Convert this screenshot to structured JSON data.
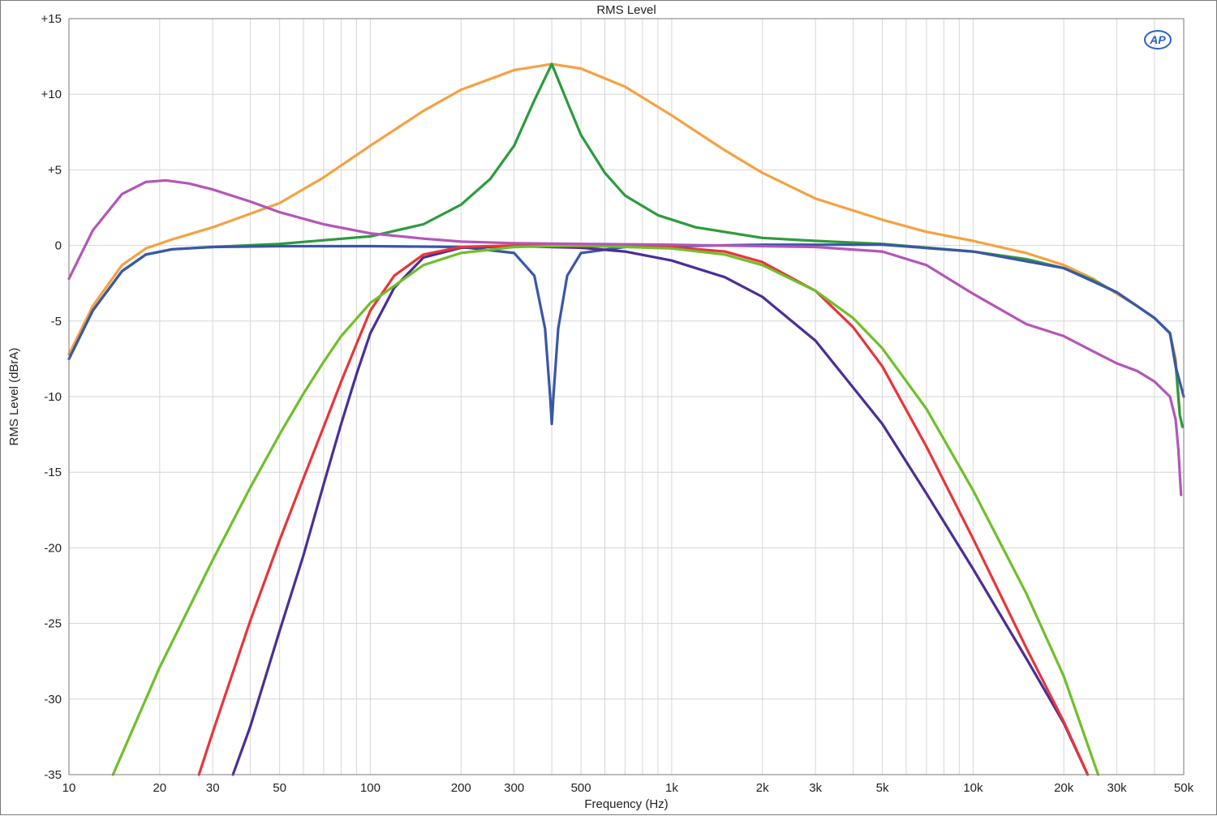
{
  "chart_data": {
    "type": "line",
    "title": "RMS Level",
    "xlabel": "Frequency (Hz)",
    "ylabel": "RMS Level (dBrA)",
    "xscale": "log",
    "xlim": [
      10,
      50000
    ],
    "ylim": [
      -35,
      15
    ],
    "grid": true,
    "x_tick_labels": [
      {
        "v": 10,
        "label": "10"
      },
      {
        "v": 20,
        "label": "20"
      },
      {
        "v": 30,
        "label": "30"
      },
      {
        "v": 50,
        "label": "50"
      },
      {
        "v": 100,
        "label": "100"
      },
      {
        "v": 200,
        "label": "200"
      },
      {
        "v": 300,
        "label": "300"
      },
      {
        "v": 500,
        "label": "500"
      },
      {
        "v": 1000,
        "label": "1k"
      },
      {
        "v": 2000,
        "label": "2k"
      },
      {
        "v": 3000,
        "label": "3k"
      },
      {
        "v": 5000,
        "label": "5k"
      },
      {
        "v": 10000,
        "label": "10k"
      },
      {
        "v": 20000,
        "label": "20k"
      },
      {
        "v": 30000,
        "label": "30k"
      },
      {
        "v": 50000,
        "label": "50k"
      }
    ],
    "y_tick_labels": [
      {
        "v": 15,
        "label": "+15"
      },
      {
        "v": 10,
        "label": "+10"
      },
      {
        "v": 5,
        "label": "+5"
      },
      {
        "v": 0,
        "label": "0"
      },
      {
        "v": -5,
        "label": "-5"
      },
      {
        "v": -10,
        "label": "-10"
      },
      {
        "v": -15,
        "label": "-15"
      },
      {
        "v": -20,
        "label": "-20"
      },
      {
        "v": -25,
        "label": "-25"
      },
      {
        "v": -30,
        "label": "-30"
      },
      {
        "v": -35,
        "label": "-35"
      }
    ],
    "series": [
      {
        "color": "#f5a142",
        "points": [
          [
            10,
            -7.2
          ],
          [
            12,
            -4.0
          ],
          [
            15,
            -1.3
          ],
          [
            18,
            -0.2
          ],
          [
            22,
            0.4
          ],
          [
            30,
            1.2
          ],
          [
            50,
            2.8
          ],
          [
            70,
            4.5
          ],
          [
            100,
            6.6
          ],
          [
            150,
            8.9
          ],
          [
            200,
            10.3
          ],
          [
            300,
            11.6
          ],
          [
            400,
            12.0
          ],
          [
            500,
            11.7
          ],
          [
            700,
            10.5
          ],
          [
            1000,
            8.6
          ],
          [
            1500,
            6.3
          ],
          [
            2000,
            4.8
          ],
          [
            3000,
            3.1
          ],
          [
            5000,
            1.7
          ],
          [
            7000,
            0.9
          ],
          [
            10000,
            0.3
          ],
          [
            15000,
            -0.5
          ],
          [
            20000,
            -1.3
          ],
          [
            25000,
            -2.2
          ],
          [
            30000,
            -3.2
          ],
          [
            35000,
            -4.0
          ],
          [
            40000,
            -4.8
          ],
          [
            45000,
            -5.8
          ],
          [
            47000,
            -7.5
          ],
          [
            48500,
            -11.0
          ]
        ]
      },
      {
        "color": "#2e9a3e",
        "points": [
          [
            10,
            -7.5
          ],
          [
            12,
            -4.3
          ],
          [
            15,
            -1.7
          ],
          [
            18,
            -0.6
          ],
          [
            22,
            -0.25
          ],
          [
            30,
            -0.1
          ],
          [
            50,
            0.1
          ],
          [
            100,
            0.6
          ],
          [
            150,
            1.4
          ],
          [
            200,
            2.7
          ],
          [
            250,
            4.4
          ],
          [
            300,
            6.6
          ],
          [
            350,
            9.6
          ],
          [
            400,
            12.0
          ],
          [
            450,
            9.5
          ],
          [
            500,
            7.3
          ],
          [
            600,
            4.8
          ],
          [
            700,
            3.3
          ],
          [
            900,
            2.0
          ],
          [
            1200,
            1.2
          ],
          [
            2000,
            0.5
          ],
          [
            3000,
            0.3
          ],
          [
            5000,
            0.1
          ],
          [
            10000,
            -0.4
          ],
          [
            15000,
            -0.9
          ],
          [
            20000,
            -1.5
          ],
          [
            25000,
            -2.3
          ],
          [
            30000,
            -3.1
          ],
          [
            35000,
            -4.0
          ],
          [
            40000,
            -4.8
          ],
          [
            45000,
            -5.8
          ],
          [
            47000,
            -7.8
          ],
          [
            48500,
            -11.2
          ],
          [
            49500,
            -12.0
          ]
        ]
      },
      {
        "color": "#3a56a8",
        "points": [
          [
            10,
            -7.5
          ],
          [
            12,
            -4.3
          ],
          [
            15,
            -1.7
          ],
          [
            18,
            -0.6
          ],
          [
            22,
            -0.25
          ],
          [
            30,
            -0.1
          ],
          [
            50,
            -0.05
          ],
          [
            100,
            -0.05
          ],
          [
            200,
            -0.1
          ],
          [
            300,
            -0.5
          ],
          [
            350,
            -2.0
          ],
          [
            380,
            -5.5
          ],
          [
            395,
            -10.0
          ],
          [
            400,
            -11.8
          ],
          [
            405,
            -10.0
          ],
          [
            420,
            -5.5
          ],
          [
            450,
            -2.0
          ],
          [
            500,
            -0.5
          ],
          [
            700,
            -0.1
          ],
          [
            1000,
            -0.05
          ],
          [
            2000,
            0.05
          ],
          [
            5000,
            0.05
          ],
          [
            10000,
            -0.4
          ],
          [
            20000,
            -1.5
          ],
          [
            30000,
            -3.1
          ],
          [
            40000,
            -4.8
          ],
          [
            45000,
            -5.8
          ],
          [
            47000,
            -8.0
          ],
          [
            50000,
            -10.0
          ]
        ]
      },
      {
        "color": "#4b2e96",
        "points": [
          [
            35,
            -35
          ],
          [
            40,
            -31.8
          ],
          [
            50,
            -25.5
          ],
          [
            60,
            -20.5
          ],
          [
            70,
            -15.8
          ],
          [
            80,
            -11.8
          ],
          [
            90,
            -8.5
          ],
          [
            100,
            -5.8
          ],
          [
            120,
            -2.8
          ],
          [
            150,
            -0.8
          ],
          [
            200,
            -0.15
          ],
          [
            300,
            -0.05
          ],
          [
            500,
            -0.15
          ],
          [
            700,
            -0.4
          ],
          [
            1000,
            -1.0
          ],
          [
            1500,
            -2.1
          ],
          [
            2000,
            -3.4
          ],
          [
            3000,
            -6.3
          ],
          [
            5000,
            -11.8
          ],
          [
            7000,
            -16.4
          ],
          [
            10000,
            -21.4
          ],
          [
            15000,
            -27.3
          ],
          [
            20000,
            -31.6
          ],
          [
            24000,
            -35
          ]
        ]
      },
      {
        "color": "#e8353a",
        "points": [
          [
            27,
            -35
          ],
          [
            30,
            -32.2
          ],
          [
            40,
            -24.8
          ],
          [
            50,
            -19.5
          ],
          [
            60,
            -15.4
          ],
          [
            70,
            -12.0
          ],
          [
            80,
            -9.0
          ],
          [
            90,
            -6.5
          ],
          [
            100,
            -4.3
          ],
          [
            120,
            -2.0
          ],
          [
            150,
            -0.6
          ],
          [
            200,
            -0.1
          ],
          [
            300,
            0.0
          ],
          [
            500,
            -0.05
          ],
          [
            1000,
            -0.1
          ],
          [
            1500,
            -0.4
          ],
          [
            2000,
            -1.1
          ],
          [
            3000,
            -3.0
          ],
          [
            4000,
            -5.4
          ],
          [
            5000,
            -8.0
          ],
          [
            7000,
            -13.3
          ],
          [
            10000,
            -19.4
          ],
          [
            15000,
            -26.6
          ],
          [
            20000,
            -31.5
          ],
          [
            24000,
            -35
          ]
        ]
      },
      {
        "color": "#6fbf2a",
        "points": [
          [
            14,
            -35
          ],
          [
            20,
            -27.9
          ],
          [
            30,
            -20.8
          ],
          [
            40,
            -16.0
          ],
          [
            50,
            -12.5
          ],
          [
            60,
            -9.8
          ],
          [
            70,
            -7.7
          ],
          [
            80,
            -6.0
          ],
          [
            100,
            -3.8
          ],
          [
            150,
            -1.3
          ],
          [
            200,
            -0.5
          ],
          [
            300,
            -0.1
          ],
          [
            500,
            0.0
          ],
          [
            1000,
            -0.2
          ],
          [
            1500,
            -0.6
          ],
          [
            2000,
            -1.3
          ],
          [
            3000,
            -3.0
          ],
          [
            4000,
            -4.8
          ],
          [
            5000,
            -6.8
          ],
          [
            7000,
            -10.8
          ],
          [
            10000,
            -16.2
          ],
          [
            15000,
            -23.0
          ],
          [
            20000,
            -28.5
          ],
          [
            26000,
            -35
          ]
        ]
      },
      {
        "color": "#b356b8",
        "points": [
          [
            10,
            -2.2
          ],
          [
            12,
            1.0
          ],
          [
            15,
            3.4
          ],
          [
            18,
            4.2
          ],
          [
            21,
            4.3
          ],
          [
            25,
            4.1
          ],
          [
            30,
            3.7
          ],
          [
            40,
            2.9
          ],
          [
            50,
            2.2
          ],
          [
            70,
            1.4
          ],
          [
            100,
            0.8
          ],
          [
            150,
            0.45
          ],
          [
            200,
            0.25
          ],
          [
            300,
            0.15
          ],
          [
            500,
            0.1
          ],
          [
            1000,
            0.05
          ],
          [
            2000,
            -0.05
          ],
          [
            3000,
            -0.1
          ],
          [
            5000,
            -0.4
          ],
          [
            7000,
            -1.3
          ],
          [
            10000,
            -3.2
          ],
          [
            15000,
            -5.2
          ],
          [
            20000,
            -6.0
          ],
          [
            25000,
            -7.0
          ],
          [
            30000,
            -7.8
          ],
          [
            35000,
            -8.3
          ],
          [
            40000,
            -9.0
          ],
          [
            45000,
            -10.0
          ],
          [
            47000,
            -11.5
          ],
          [
            48000,
            -13.5
          ],
          [
            49000,
            -16.5
          ]
        ]
      }
    ]
  },
  "logo_text": "AP"
}
